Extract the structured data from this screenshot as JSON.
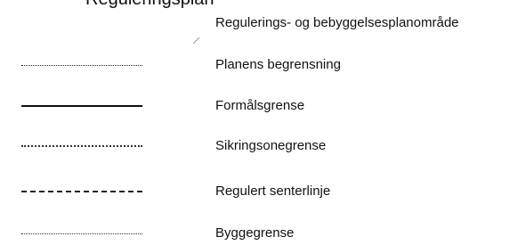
{
  "header": {
    "cut_text": "Reguleringsplan"
  },
  "section": {
    "title": "Regulerings- og bebyggelsesplanområde"
  },
  "legend": [
    {
      "label": "Planens begrensning",
      "line_style": "dotted-dense"
    },
    {
      "label": "Formålsgrense",
      "line_style": "solid"
    },
    {
      "label": "Sikringsonegrense",
      "line_style": "dotted-sparse"
    },
    {
      "label": "Regulert senterlinje",
      "line_style": "dashed"
    },
    {
      "label": "Byggegrense",
      "line_style": "dotted-fine"
    }
  ],
  "colors": {
    "text": "#111111",
    "background": "#ffffff"
  }
}
